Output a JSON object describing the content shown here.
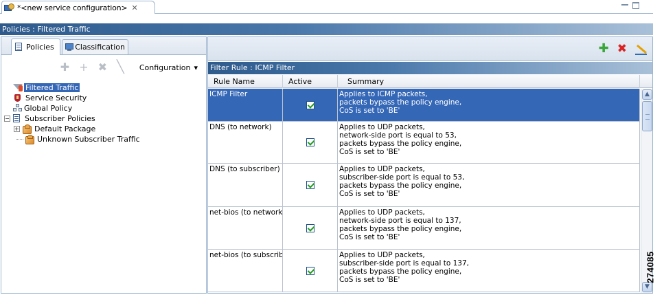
{
  "editor_tab": {
    "title": "*<new service configuration>",
    "close_glyph": "✕"
  },
  "page_header": {
    "title": "Policies : Filtered Traffic"
  },
  "left_tabs": [
    {
      "label": "Policies",
      "icon": "policy-icon",
      "active": true
    },
    {
      "label": "Classification",
      "icon": "classification-icon",
      "active": false
    }
  ],
  "left_toolbar": {
    "configuration_label": "Configuration",
    "dropdown_glyph": "▾"
  },
  "tree": [
    {
      "label": "Filtered Traffic",
      "icon": "filter-icon",
      "selected": true
    },
    {
      "label": "Service Security",
      "icon": "security-icon",
      "selected": false
    },
    {
      "label": "Global Policy",
      "icon": "global-policy-icon",
      "selected": false
    },
    {
      "label": "Subscriber Policies",
      "icon": "subscriber-policies-icon",
      "expander": "−"
    },
    {
      "label": "Default Package",
      "icon": "package-icon",
      "expander": "+"
    },
    {
      "label": "Unknown Subscriber Traffic",
      "icon": "package-icon"
    }
  ],
  "rule_header": {
    "title": "Filter Rule : ICMP Filter"
  },
  "table": {
    "columns": [
      "Rule Name",
      "Active",
      "Summary"
    ],
    "rows": [
      {
        "name": "ICMP Filter",
        "active": true,
        "selected": true,
        "summary": [
          "Applies to ICMP packets,",
          "packets bypass the policy engine,",
          "CoS is set to 'BE'"
        ]
      },
      {
        "name": "DNS (to network)",
        "active": true,
        "summary": [
          "Applies to UDP packets,",
          "network-side port is equal to 53,",
          "packets bypass the policy engine,",
          "CoS is set to 'BE'"
        ]
      },
      {
        "name": "DNS (to subscriber)",
        "active": true,
        "summary": [
          "Applies to UDP packets,",
          "subscriber-side port is equal to 53,",
          "packets bypass the policy engine,",
          "CoS is set to 'BE'"
        ]
      },
      {
        "name": "net-bios (to network",
        "active": true,
        "summary": [
          "Applies to UDP packets,",
          "network-side port is equal to 137,",
          "packets bypass the policy engine,",
          "CoS is set to 'BE'"
        ]
      },
      {
        "name": "net-bios (to subscrib",
        "active": true,
        "summary": [
          "Applies to UDP packets,",
          "subscriber-side port is equal to 137,",
          "packets bypass the policy engine,",
          "CoS is set to 'BE'"
        ]
      }
    ]
  },
  "figure_code": "274085",
  "colors": {
    "header_blue": "#2e5a8c",
    "selection_blue": "#3567b7",
    "add_green": "#3aa63a",
    "delete_red": "#d92424"
  }
}
